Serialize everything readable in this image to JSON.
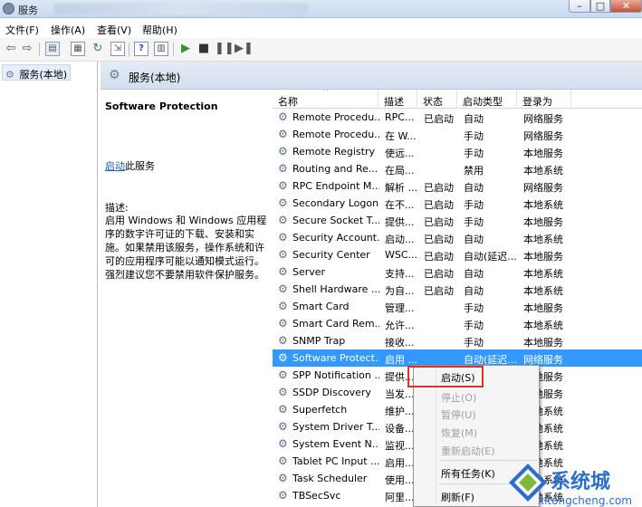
{
  "window": {
    "title": "服务"
  },
  "menu": [
    "文件(F)",
    "操作(A)",
    "查看(V)",
    "帮助(H)"
  ],
  "nav": {
    "item": "服务(本地)"
  },
  "content": {
    "header": "服务(本地)",
    "selected_service": "Software Protection",
    "start_link": "启动",
    "start_suffix": "此服务",
    "desc_label": "描述:",
    "description": "启用 Windows 和 Windows 应用程序的数字许可证的下载、安装和实施。如果禁用该服务，操作系统和许可的应用程序可能以通知模式运行。强烈建议您不要禁用软件保护服务。"
  },
  "columns": [
    "名称",
    "描述",
    "状态",
    "启动类型",
    "登录为"
  ],
  "rows": [
    {
      "name": "Remote Procedu...",
      "desc": "RPC...",
      "status": "已启动",
      "start": "自动",
      "logon": "网络服务"
    },
    {
      "name": "Remote Procedu...",
      "desc": "在 W...",
      "status": "",
      "start": "手动",
      "logon": "网络服务"
    },
    {
      "name": "Remote Registry",
      "desc": "使远...",
      "status": "",
      "start": "手动",
      "logon": "本地服务"
    },
    {
      "name": "Routing and Re...",
      "desc": "在局...",
      "status": "",
      "start": "禁用",
      "logon": "本地系统"
    },
    {
      "name": "RPC Endpoint M...",
      "desc": "解析 ...",
      "status": "已启动",
      "start": "自动",
      "logon": "网络服务"
    },
    {
      "name": "Secondary Logon",
      "desc": "在不...",
      "status": "已启动",
      "start": "手动",
      "logon": "本地系统"
    },
    {
      "name": "Secure Socket T...",
      "desc": "提供...",
      "status": "已启动",
      "start": "手动",
      "logon": "本地服务"
    },
    {
      "name": "Security Account...",
      "desc": "启动...",
      "status": "已启动",
      "start": "自动",
      "logon": "本地系统"
    },
    {
      "name": "Security Center",
      "desc": "WSC...",
      "status": "已启动",
      "start": "自动(延迟...",
      "logon": "本地服务"
    },
    {
      "name": "Server",
      "desc": "支持...",
      "status": "已启动",
      "start": "自动",
      "logon": "本地系统"
    },
    {
      "name": "Shell Hardware ...",
      "desc": "为自...",
      "status": "已启动",
      "start": "自动",
      "logon": "本地系统"
    },
    {
      "name": "Smart Card",
      "desc": "管理...",
      "status": "",
      "start": "手动",
      "logon": "本地服务"
    },
    {
      "name": "Smart Card Rem...",
      "desc": "允许...",
      "status": "",
      "start": "手动",
      "logon": "本地系统"
    },
    {
      "name": "SNMP Trap",
      "desc": "接收...",
      "status": "",
      "start": "手动",
      "logon": "本地服务"
    },
    {
      "name": "Software Protect...",
      "desc": "启用 ...",
      "status": "",
      "start": "自动(延迟...",
      "logon": "网络服务"
    },
    {
      "name": "SPP Notification ...",
      "desc": "提供...",
      "status": "",
      "start": "",
      "logon": "本地服务"
    },
    {
      "name": "SSDP Discovery",
      "desc": "当发...",
      "status": "",
      "start": "",
      "logon": "本地服务"
    },
    {
      "name": "Superfetch",
      "desc": "维护...",
      "status": "",
      "start": "",
      "logon": "本地系统"
    },
    {
      "name": "System Driver T...",
      "desc": "设备...",
      "status": "",
      "start": "",
      "logon": "本地系统"
    },
    {
      "name": "System Event N...",
      "desc": "监视...",
      "status": "",
      "start": "",
      "logon": "本地系统"
    },
    {
      "name": "Tablet PC Input ...",
      "desc": "启用...",
      "status": "",
      "start": "",
      "logon": "本地系统"
    },
    {
      "name": "Task Scheduler",
      "desc": "使用...",
      "status": "",
      "start": "",
      "logon": "本地系统"
    },
    {
      "name": "TBSecSvc",
      "desc": "阿里...",
      "status": "",
      "start": "",
      "logon": "本地系统"
    }
  ],
  "context_menu": {
    "start": "启动(S)",
    "stop": "停止(O)",
    "pause": "暂停(U)",
    "resume": "恢复(M)",
    "restart": "重新启动(E)",
    "all_tasks": "所有任务(K)",
    "refresh": "刷新(F)"
  },
  "watermark": {
    "brand": "系统城",
    "domain": "xitongcheng.com"
  },
  "colors": {
    "selection": "#3399ff",
    "highlight_box": "#d9352f",
    "link": "#1f55b3",
    "watermark": "#2b6fcb"
  }
}
